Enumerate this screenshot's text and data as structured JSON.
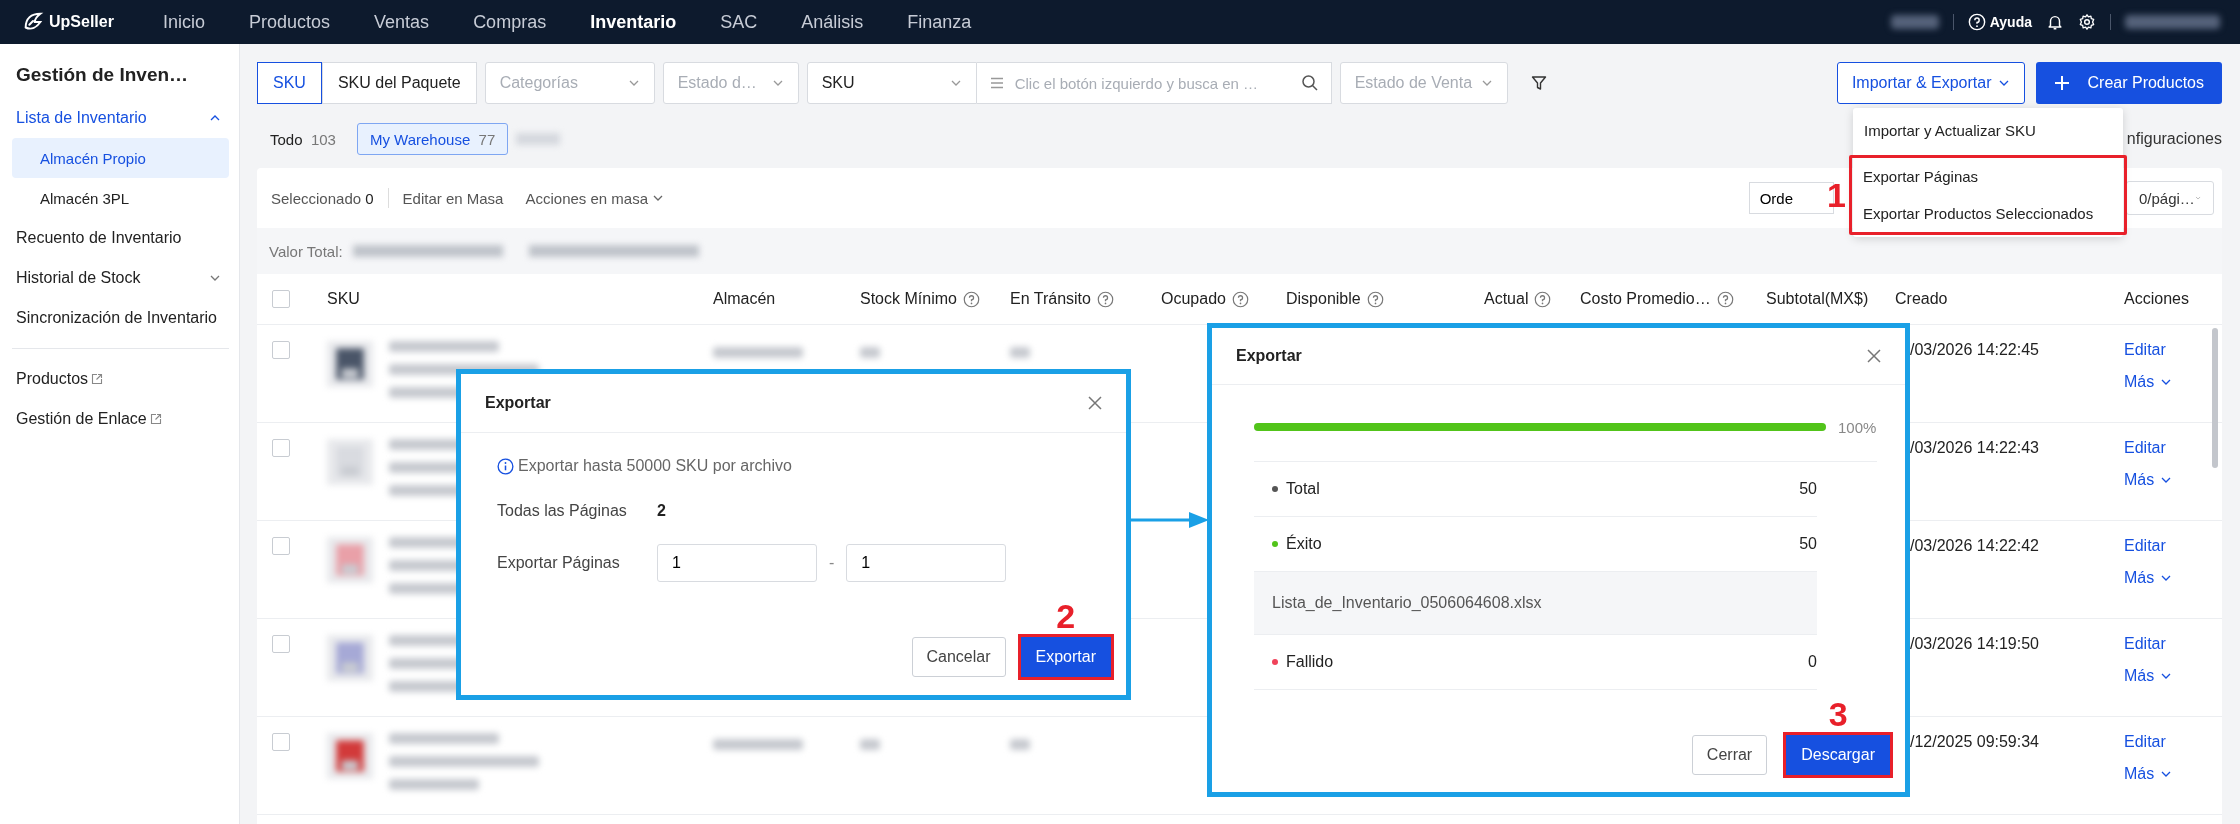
{
  "nav": {
    "logo": "UpSeller",
    "items": [
      {
        "label": "Inicio",
        "selected": false
      },
      {
        "label": "Productos",
        "selected": false
      },
      {
        "label": "Ventas",
        "selected": false
      },
      {
        "label": "Compras",
        "selected": false
      },
      {
        "label": "Inventario",
        "selected": true
      },
      {
        "label": "SAC",
        "selected": false
      },
      {
        "label": "Análisis",
        "selected": false
      },
      {
        "label": "Finanza",
        "selected": false
      }
    ],
    "help": "Ayuda"
  },
  "sidebar": {
    "title": "Gestión de Inven…",
    "items": [
      {
        "kind": "group",
        "label": "Lista de Inventario",
        "expanded": true,
        "children": [
          {
            "label": "Almacén Propio",
            "selected": true
          },
          {
            "label": "Almacén 3PL",
            "selected": false
          }
        ]
      },
      {
        "kind": "plain",
        "label": "Recuento de Inventario"
      },
      {
        "kind": "group",
        "label": "Historial de Stock",
        "expanded": false
      },
      {
        "kind": "plain",
        "label": "Sincronización de Inventario"
      },
      {
        "kind": "external",
        "label": "Productos"
      },
      {
        "kind": "external",
        "label": "Gestión de Enlace"
      }
    ]
  },
  "toolbar": {
    "segments": [
      {
        "label": "SKU",
        "selected": true
      },
      {
        "label": "SKU del Paquete",
        "selected": false
      }
    ],
    "filters_before": [
      "Categorías",
      "Estado d…"
    ],
    "search": {
      "scope": "SKU",
      "placeholder": "Clic el botón izquierdo y busca en …"
    },
    "filters_after": [
      "Estado de Venta"
    ],
    "import_export": "Importar & Exportar",
    "create": "Crear Productos"
  },
  "warehouse_tabs": [
    {
      "label": "Todo",
      "count": "103",
      "selected": false
    },
    {
      "label": "My Warehouse",
      "count": "77",
      "selected": true
    }
  ],
  "settings_partial": "nfiguraciones",
  "actions_bar": {
    "selected_label": "Seleccionado",
    "selected_count": "0",
    "bulk_edit": "Editar en Masa",
    "bulk_actions": "Acciones en masa",
    "sort_partial": "Orde",
    "page_size": "0/pági…"
  },
  "total_label": "Valor Total:",
  "table": {
    "header_checked": false,
    "columns": [
      {
        "label": "SKU",
        "help": false
      },
      {
        "label": "Almacén",
        "help": false
      },
      {
        "label": "Stock Mínimo",
        "help": true
      },
      {
        "label": "En Tránsito",
        "help": true
      },
      {
        "label": "Ocupado",
        "help": true
      },
      {
        "label": "Disponible",
        "help": true
      },
      {
        "label": "Actual",
        "help": true
      },
      {
        "label": "Costo Promedio…",
        "help": true
      },
      {
        "label": "Subtotal(MX$)",
        "help": false
      },
      {
        "label": "Creado",
        "help": false
      },
      {
        "label": "Acciones",
        "help": false
      }
    ],
    "rows": [
      {
        "checked": false,
        "created": "/03/2026 14:22:45",
        "actions": [
          "Editar",
          "Más"
        ]
      },
      {
        "checked": false,
        "created": "/03/2026 14:22:43",
        "actions": [
          "Editar",
          "Más"
        ]
      },
      {
        "checked": false,
        "created": "/03/2026 14:22:42",
        "actions": [
          "Editar",
          "Más"
        ]
      },
      {
        "checked": false,
        "created": "/03/2026 14:19:50",
        "actions": [
          "Editar",
          "Más"
        ]
      },
      {
        "checked": false,
        "created": "/12/2025 09:59:34",
        "actions": [
          "Editar",
          "Más"
        ]
      }
    ]
  },
  "import_menu": {
    "step": "1",
    "items": [
      {
        "label": "Importar y Actualizar SKU",
        "highlighted": false
      },
      {
        "label": "Exportar Páginas",
        "highlighted": true
      },
      {
        "label": "Exportar Productos Seleccionados",
        "highlighted": true
      }
    ]
  },
  "export_dialog": {
    "title": "Exportar",
    "info": "Exportar hasta 50000 SKU por archivo",
    "total_pages_label": "Todas las Páginas",
    "total_pages": "2",
    "range_label": "Exportar Páginas",
    "from": "1",
    "separator": "-",
    "to": "1",
    "step": "2",
    "buttons": [
      {
        "label": "Cancelar",
        "primary": false,
        "highlighted": false
      },
      {
        "label": "Exportar",
        "primary": true,
        "highlighted": true
      }
    ]
  },
  "progress_dialog": {
    "title": "Exportar",
    "level": 1,
    "percent": "100%",
    "step": "3",
    "rows": [
      {
        "kind": "stat",
        "label": "Total",
        "value": "50",
        "color": "#555555"
      },
      {
        "kind": "stat",
        "label": "Éxito",
        "value": "50",
        "color": "#52c41a"
      },
      {
        "kind": "file",
        "label": "Lista_de_Inventario_0506064608.xlsx"
      },
      {
        "kind": "stat",
        "label": "Fallido",
        "value": "0",
        "color": "#f0435a"
      }
    ],
    "buttons": [
      {
        "label": "Cerrar",
        "primary": false,
        "highlighted": false
      },
      {
        "label": "Descargar",
        "primary": true,
        "highlighted": true
      }
    ]
  }
}
